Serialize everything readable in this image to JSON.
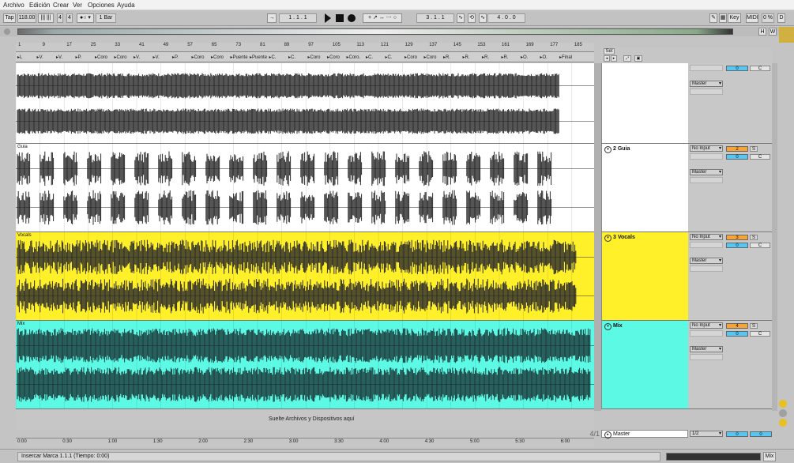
{
  "menu": [
    "Archivo",
    "Edición",
    "Crear",
    "Ver",
    "Opciones",
    "Ayuda"
  ],
  "transport": {
    "tap": "Tap",
    "tempo": "118.00",
    "signature_num": "4",
    "signature_den": "4",
    "quant": "1 Bar",
    "position": "1 . 1 . 1",
    "loop_start": "3 . 1 . 1",
    "loop_length": "4 . 0 . 0",
    "key": "Key",
    "midi": "MIDI",
    "cpu": "0 %",
    "d": "D",
    "overview_h": "H",
    "overview_w": "W"
  },
  "ruler_ticks": [
    "1",
    "9",
    "17",
    "25",
    "33",
    "41",
    "49",
    "57",
    "65",
    "73",
    "81",
    "89",
    "97",
    "105",
    "113",
    "121",
    "129",
    "137",
    "145",
    "153",
    "161",
    "169",
    "177",
    "185"
  ],
  "locators": [
    "L",
    "V.",
    "V.",
    "P.",
    "Coro",
    "Coro",
    "V.",
    "V.",
    "P.",
    "Coro",
    "Coro",
    "Puente",
    "Puente",
    "C.",
    "C.",
    "Coro",
    "Coro",
    "Coro.",
    "C.",
    "C.",
    "Coro",
    "Coro",
    "R.",
    "R.",
    "R.",
    "R.",
    "O.",
    "O.",
    "Final"
  ],
  "set_label": "Set",
  "tracks": [
    {
      "clip": "",
      "name": "",
      "input": "",
      "output": "Master",
      "number": "",
      "volume": "0",
      "pan": "C"
    },
    {
      "clip": "Guia",
      "name": "2 Guia",
      "input": "No Input",
      "output": "Master",
      "number": "2",
      "solo": "S",
      "volume": "0",
      "pan": "C"
    },
    {
      "clip": "Vocals",
      "name": "3 Vocals",
      "input": "No Input",
      "output": "Master",
      "number": "3",
      "solo": "S",
      "volume": "0",
      "pan": "C"
    },
    {
      "clip": "Mix",
      "name": "Mix",
      "input": "No Input",
      "output": "Master",
      "number": "4",
      "solo": "S",
      "volume": "0",
      "pan": "C"
    }
  ],
  "drop_text": "Suelte Archivos y Dispositivos aquí",
  "master": {
    "name": "Master",
    "page": "4/1",
    "out": "1/2",
    "volume": "0",
    "vol2": "0"
  },
  "time_ticks": [
    "0:00",
    "0:30",
    "1:00",
    "1:30",
    "2:00",
    "2:30",
    "3:00",
    "3:30",
    "4:00",
    "4:30",
    "5:00",
    "5:30",
    "6:00"
  ],
  "status": {
    "text": "Insercar Marca 1.1.1 (Tiempo: 0:00)",
    "mix": "Mix"
  },
  "colors": {
    "yellow": "#fff02a",
    "cyan": "#5cfae5",
    "white": "#ffffff",
    "orange": "#f7a434",
    "blue": "#55c7f5"
  }
}
